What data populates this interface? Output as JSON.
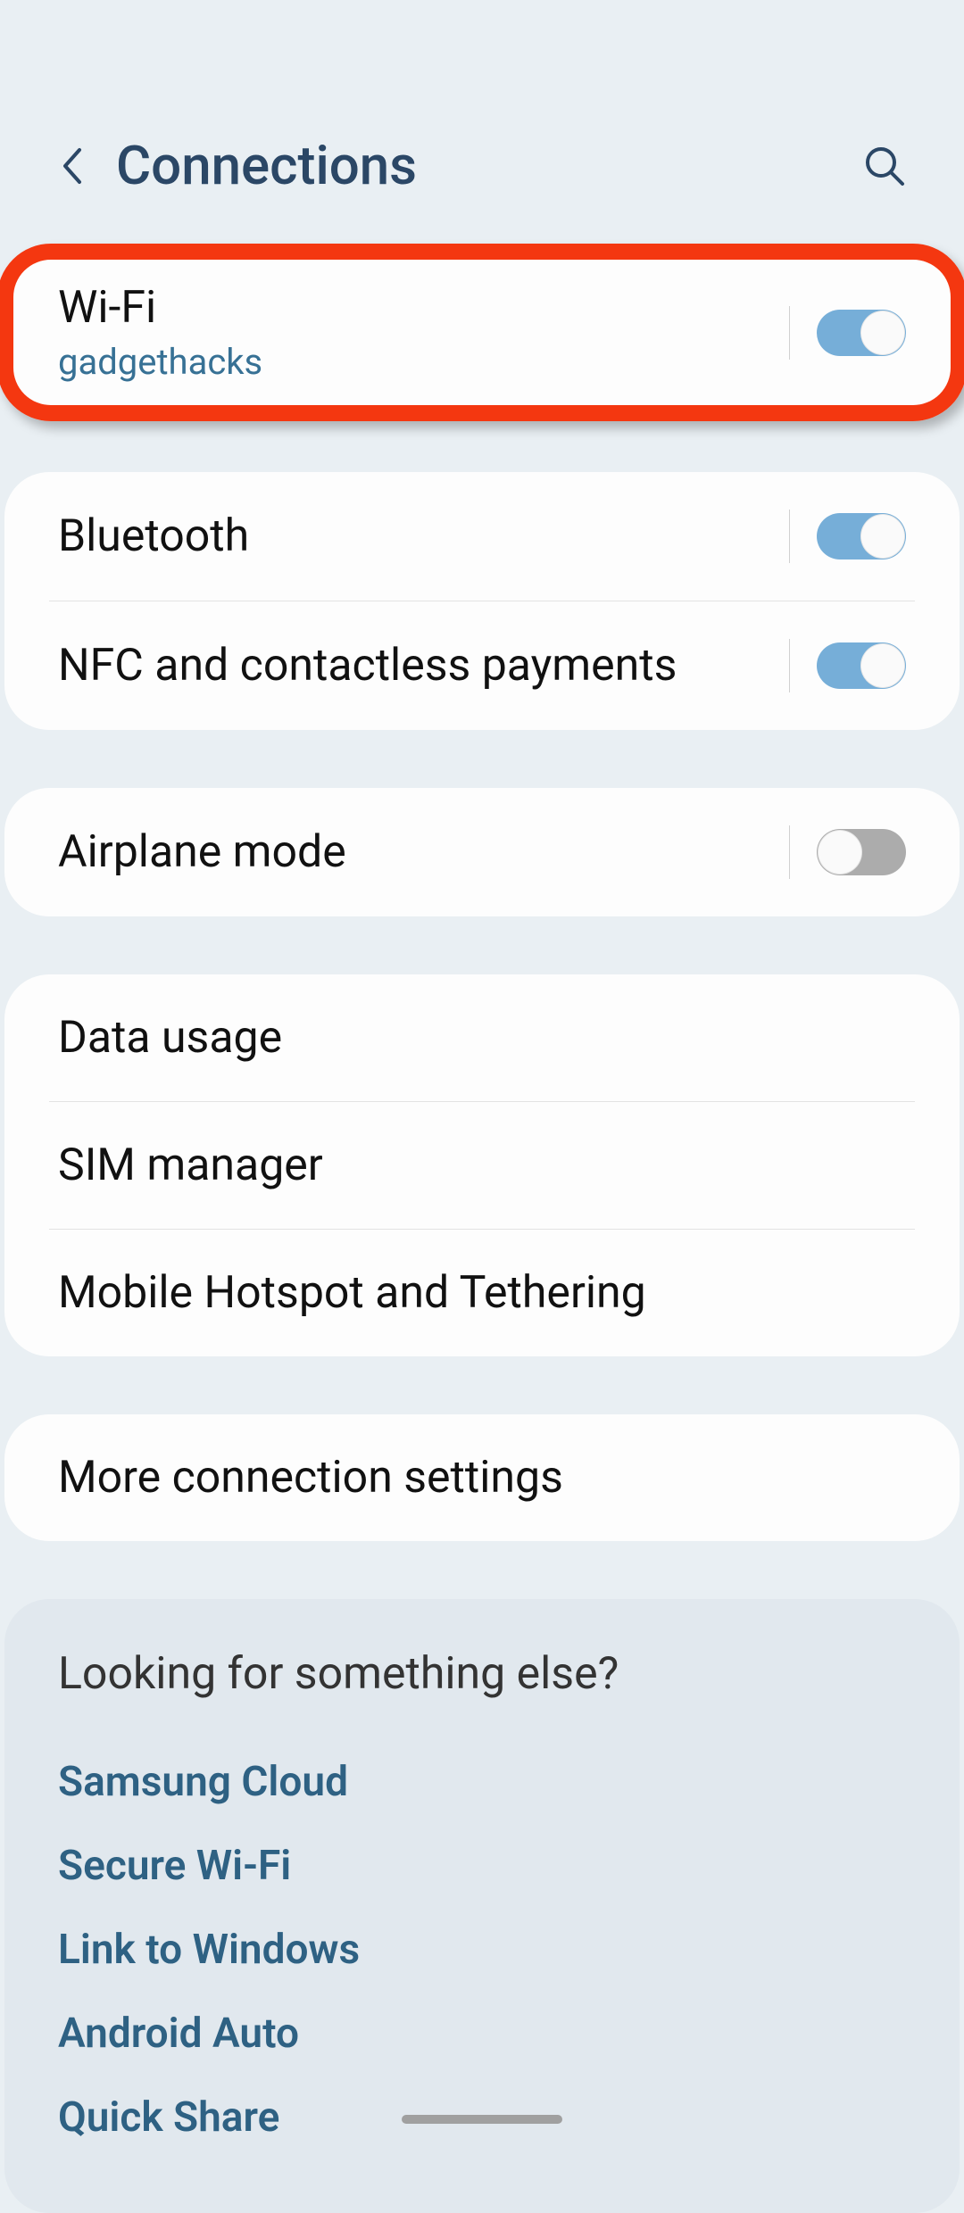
{
  "header": {
    "title": "Connections"
  },
  "groups": [
    {
      "highlighted": true,
      "rows": [
        {
          "title": "Wi-Fi",
          "subtitle": "gadgethacks",
          "toggle": true
        }
      ]
    },
    {
      "rows": [
        {
          "title": "Bluetooth",
          "toggle": true
        },
        {
          "title": "NFC and contactless payments",
          "toggle": true
        }
      ]
    },
    {
      "rows": [
        {
          "title": "Airplane mode",
          "toggle": false
        }
      ]
    },
    {
      "rows": [
        {
          "title": "Data usage"
        },
        {
          "title": "SIM manager"
        },
        {
          "title": "Mobile Hotspot and Tethering"
        }
      ]
    },
    {
      "rows": [
        {
          "title": "More connection settings"
        }
      ]
    }
  ],
  "suggestions": {
    "title": "Looking for something else?",
    "links": [
      "Samsung Cloud",
      "Secure Wi-Fi",
      "Link to Windows",
      "Android Auto",
      "Quick Share"
    ]
  }
}
